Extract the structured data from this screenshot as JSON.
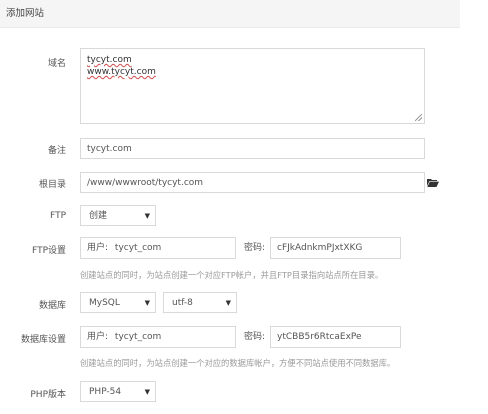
{
  "header": {
    "title": "添加网站"
  },
  "domain": {
    "label": "域名",
    "lines": [
      "tycyt.com",
      "www.tycyt.com"
    ]
  },
  "remark": {
    "label": "备注",
    "value": "tycyt.com"
  },
  "root_dir": {
    "label": "根目录",
    "value": "/www/wwwroot/tycyt.com",
    "icon": "folder-open-icon"
  },
  "ftp": {
    "label": "FTP",
    "option": "创建"
  },
  "ftp_settings": {
    "label": "FTP设置",
    "user_label": "用户:",
    "user_value": "tycyt_com",
    "pass_label": "密码:",
    "pass_value": "cFJkAdnkmPJxtXKG",
    "help": "创建站点的同时，为站点创建一个对应FTP帐户，并且FTP目录指向站点所在目录。"
  },
  "database": {
    "label": "数据库",
    "type": "MySQL",
    "charset": "utf-8"
  },
  "db_settings": {
    "label": "数据库设置",
    "user_label": "用户:",
    "user_value": "tycyt_com",
    "pass_label": "密码:",
    "pass_value": "ytCBB5r6RtcaExPe",
    "help": "创建站点的同时，为站点创建一个对应的数据库帐户，方便不同站点使用不同数据库。"
  },
  "php": {
    "label": "PHP版本",
    "version": "PHP-54"
  },
  "colors": {
    "border": "#d9d9d9",
    "header_bg": "#f5f5f5",
    "help_text": "#9a9a9a"
  }
}
